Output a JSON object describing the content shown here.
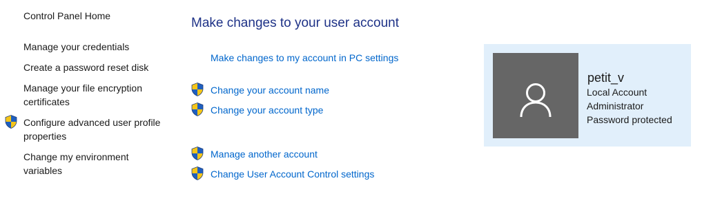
{
  "sidebar": {
    "items": [
      {
        "label": "Control Panel Home",
        "shield": false
      },
      {
        "label": "Manage your credentials",
        "shield": false
      },
      {
        "label": "Create a password reset disk",
        "shield": false
      },
      {
        "label": "Manage your file encryption certificates",
        "shield": false
      },
      {
        "label": "Configure advanced user profile properties",
        "shield": true
      },
      {
        "label": "Change my environment variables",
        "shield": false
      }
    ]
  },
  "main": {
    "title": "Make changes to your user account",
    "links": [
      {
        "label": "Make changes to my account in PC settings",
        "shield": false
      },
      {
        "label": "Change your account name",
        "shield": true
      },
      {
        "label": "Change your account type",
        "shield": true
      },
      {
        "label": "Manage another account",
        "shield": true
      },
      {
        "label": "Change User Account Control settings",
        "shield": true
      }
    ]
  },
  "account": {
    "name": "petit_v",
    "details": [
      "Local Account",
      "Administrator",
      "Password protected"
    ]
  },
  "colors": {
    "link": "#0066cc",
    "title": "#1e3287",
    "card_bg": "#e1effb",
    "avatar_bg": "#666666"
  },
  "icons": {
    "shield": "uac-shield-icon",
    "avatar": "user-silhouette-icon"
  }
}
